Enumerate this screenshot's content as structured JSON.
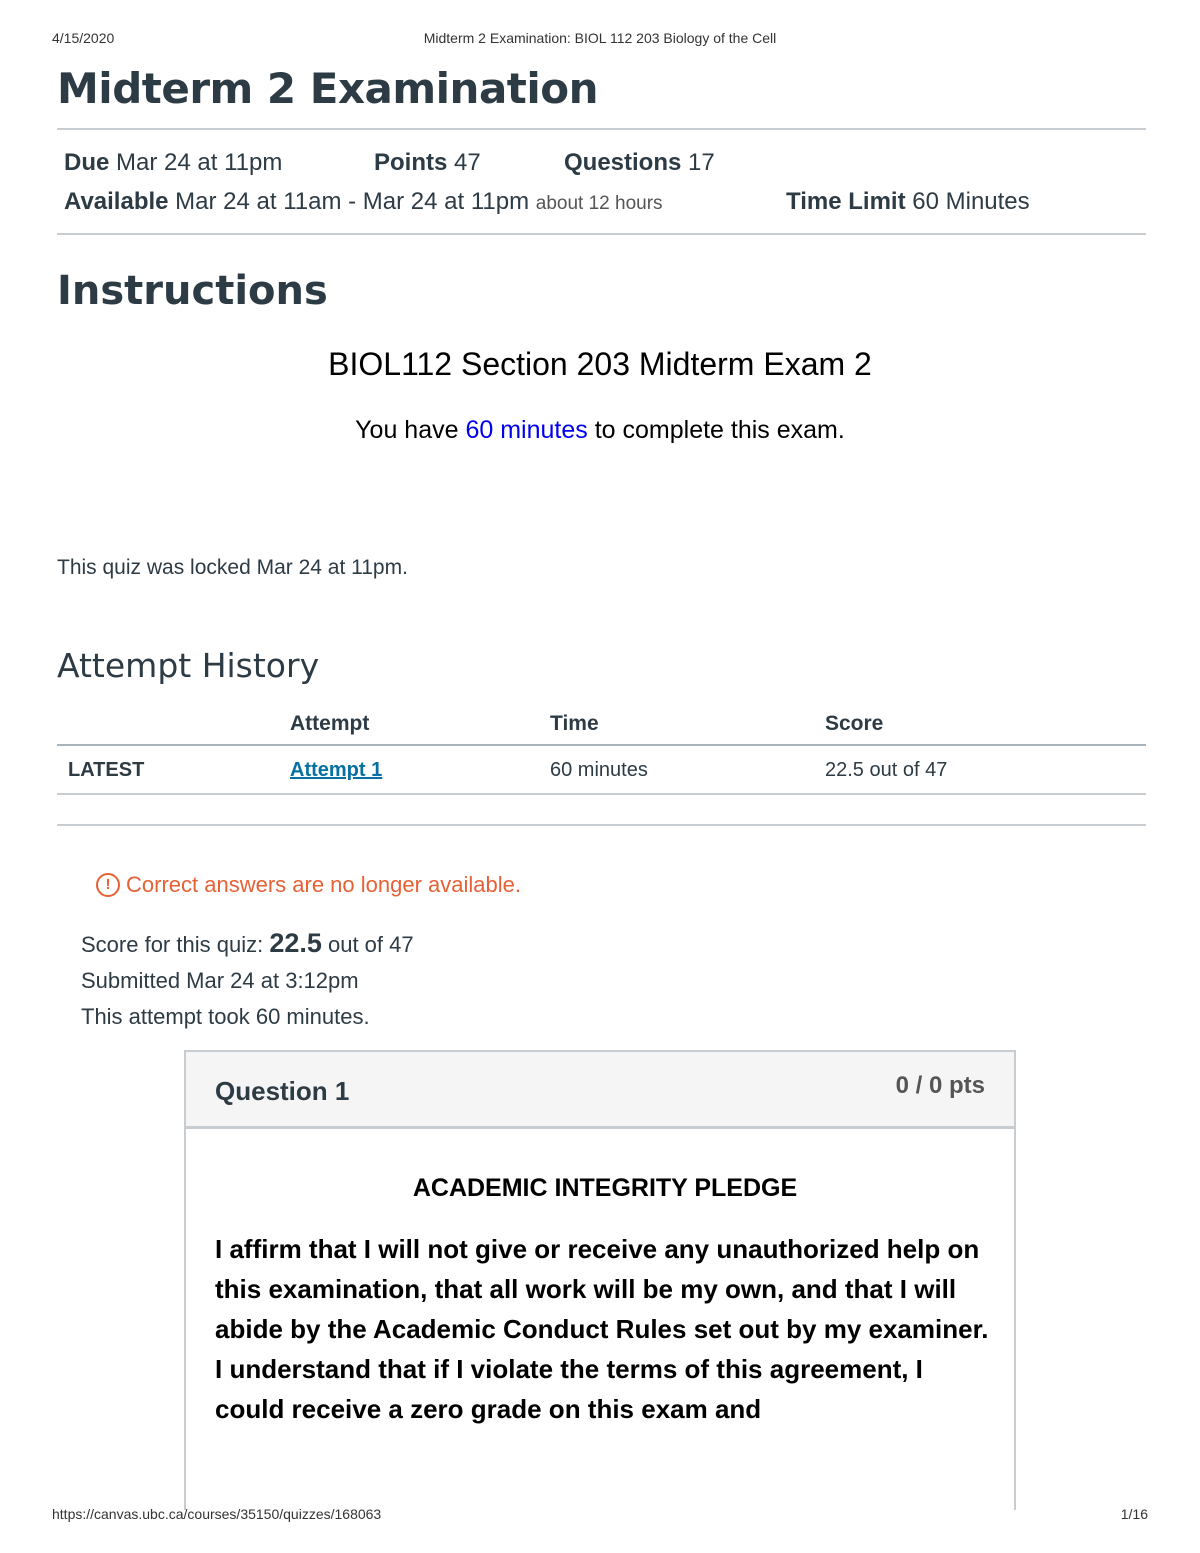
{
  "print_header": {
    "date": "4/15/2020",
    "title": "Midterm 2 Examination: BIOL 112 203 Biology of the Cell"
  },
  "quiz": {
    "title": "Midterm 2 Examination",
    "due_label": "Due",
    "due_value": "Mar 24 at 11pm",
    "points_label": "Points",
    "points_value": "47",
    "questions_label": "Questions",
    "questions_value": "17",
    "available_label": "Available",
    "available_value": "Mar 24 at 11am - Mar 24 at 11pm",
    "available_note": "about 12 hours",
    "time_limit_label": "Time Limit",
    "time_limit_value": "60 Minutes"
  },
  "instructions": {
    "heading": "Instructions",
    "exam_name": "BIOL112 Section 203 Midterm Exam 2",
    "time_prefix": "You have ",
    "time_highlight": "60 minutes",
    "time_suffix": " to complete this exam."
  },
  "locked_text": "This quiz was locked Mar 24 at 11pm.",
  "attempt_history": {
    "heading": "Attempt History",
    "columns": [
      "Attempt",
      "Time",
      "Score"
    ],
    "rows": [
      {
        "label": "LATEST",
        "attempt": "Attempt 1",
        "time": "60 minutes",
        "score": "22.5 out of 47"
      }
    ]
  },
  "results": {
    "notice_icon": "!",
    "notice": "Correct answers are no longer available.",
    "score_prefix": "Score for this quiz: ",
    "score_value": "22.5",
    "score_suffix": " out of 47",
    "submitted": "Submitted Mar 24 at 3:12pm",
    "duration": "This attempt took 60 minutes."
  },
  "question": {
    "title": "Question 1",
    "points": "0 / 0 pts",
    "heading": "ACADEMIC INTEGRITY PLEDGE",
    "text": "I affirm that I will not give or receive any unauthorized help on this examination, that all work will be my own, and that I will abide by the Academic Conduct Rules set out by my examiner. I understand that if I violate the terms of this agreement, I could  receive a zero grade on this exam and"
  },
  "print_footer": {
    "url": "https://canvas.ubc.ca/courses/35150/quizzes/168063",
    "page": "1/16"
  },
  "colors": {
    "text": "#2d3b45",
    "link": "#0770a3",
    "warning": "#e66135",
    "border": "#c7cdd1",
    "highlight_blue": "#0000ee"
  },
  "icons": {
    "notice": "warning-circle-icon"
  }
}
